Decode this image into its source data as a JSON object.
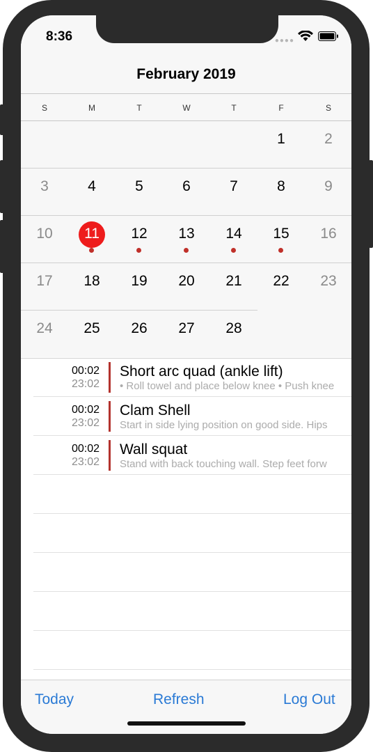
{
  "status_bar": {
    "time": "8:36"
  },
  "calendar": {
    "month_title": "February 2019",
    "weekdays": [
      "S",
      "M",
      "T",
      "W",
      "T",
      "F",
      "S"
    ],
    "weeks": [
      [
        "",
        "",
        "",
        "",
        "",
        "1",
        "2"
      ],
      [
        "3",
        "4",
        "5",
        "6",
        "7",
        "8",
        "9"
      ],
      [
        "10",
        "11",
        "12",
        "13",
        "14",
        "15",
        "16"
      ],
      [
        "17",
        "18",
        "19",
        "20",
        "21",
        "22",
        "23"
      ],
      [
        "24",
        "25",
        "26",
        "27",
        "28",
        "",
        ""
      ]
    ],
    "selected_day": "11",
    "event_days": [
      "11",
      "12",
      "13",
      "14",
      "15"
    ],
    "colors": {
      "selected": "#ee1c1c",
      "event_dot": "#c0302a"
    }
  },
  "events": [
    {
      "start": "00:02",
      "end": "23:02",
      "title": "Short arc quad (ankle lift)",
      "description": "• Roll towel and place below knee • Push knee"
    },
    {
      "start": "00:02",
      "end": "23:02",
      "title": "Clam Shell",
      "description": "Start in side lying position on good side. Hips"
    },
    {
      "start": "00:02",
      "end": "23:02",
      "title": "Wall squat",
      "description": "Stand with back touching wall. Step feet forw"
    }
  ],
  "toolbar": {
    "today_label": "Today",
    "refresh_label": "Refresh",
    "logout_label": "Log Out"
  },
  "accent_color": "#2a7ad5"
}
